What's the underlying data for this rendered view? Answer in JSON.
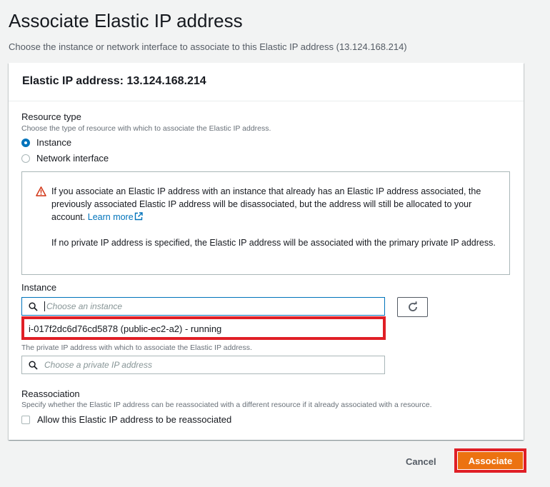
{
  "page": {
    "title": "Associate Elastic IP address",
    "subtitle": "Choose the instance or network interface to associate to this Elastic IP address (13.124.168.214)"
  },
  "card": {
    "header": "Elastic IP address: 13.124.168.214"
  },
  "resource_type": {
    "label": "Resource type",
    "description": "Choose the type of resource with which to associate the Elastic IP address.",
    "options": [
      {
        "label": "Instance",
        "selected": true
      },
      {
        "label": "Network interface",
        "selected": false
      }
    ]
  },
  "alert": {
    "icon": "warning-icon",
    "text1": "If you associate an Elastic IP address with an instance that already has an Elastic IP address associated, the previously associated Elastic IP address will be disassociated, but the address will still be allocated to your account.",
    "link": "Learn more",
    "text2": "If no private IP address is specified, the Elastic IP address will be associated with the primary private IP address."
  },
  "instance": {
    "label": "Instance",
    "placeholder": "Choose an instance",
    "option": "i-017f2dc6d76cd5878 (public-ec2-a2) - running"
  },
  "private_ip": {
    "description": "The private IP address with which to associate the Elastic IP address.",
    "placeholder": "Choose a private IP address"
  },
  "reassociation": {
    "label": "Reassociation",
    "description": "Specify whether the Elastic IP address can be reassociated with a different resource if it already associated with a resource.",
    "checkbox_label": "Allow this Elastic IP address to be reassociated",
    "checked": false
  },
  "actions": {
    "cancel": "Cancel",
    "associate": "Associate"
  },
  "colors": {
    "primary": "#ec7211",
    "link": "#0073bb",
    "highlight": "#e01f26",
    "warning": "#d13212"
  }
}
